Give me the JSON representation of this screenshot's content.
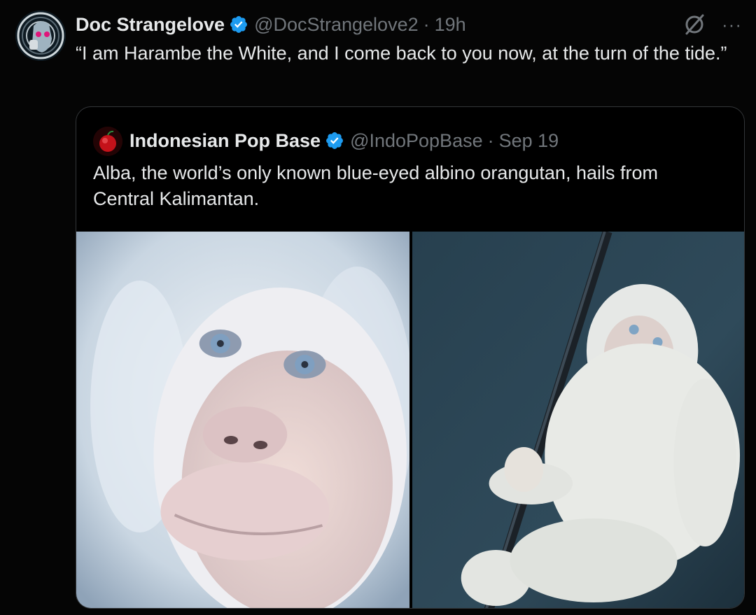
{
  "tweet": {
    "display_name": "Doc Strangelove",
    "handle": "@DocStrangelove2",
    "separator": "·",
    "time": "19h",
    "text": "“I am Harambe the White, and I come back to you now, at the turn of the tide.”",
    "more_label": "···"
  },
  "quote": {
    "display_name": "Indonesian Pop Base",
    "handle": "@IndoPopBase",
    "separator": "·",
    "time": "Sep 19",
    "text": "Alba, the world’s only known blue-eyed albino orangutan, hails from Central Kalimantan."
  },
  "icons": {
    "verified": "verified-badge-icon",
    "grok": "grok-icon",
    "more": "more-icon"
  },
  "colors": {
    "background": "#000000",
    "text_primary": "#e7e9ea",
    "text_secondary": "#71767b",
    "verified_blue": "#1d9bf0",
    "border": "#333639"
  }
}
